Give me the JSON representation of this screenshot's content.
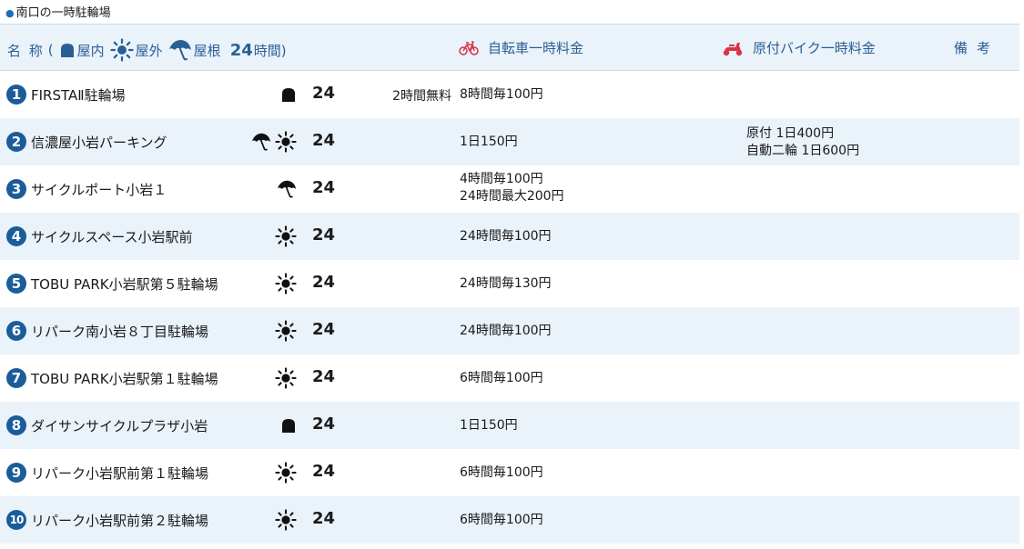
{
  "section": {
    "title": "南口の一時駐輪場"
  },
  "header": {
    "name_label": "名 称",
    "legend_open_paren": "(",
    "legend_indoor": "屋内",
    "legend_outdoor": "屋外",
    "legend_roof": "屋根",
    "legend_24": "24",
    "legend_hours": "時間)",
    "bike_fee": "自転車一時料金",
    "moto_fee": "原付バイク一時料金",
    "remarks": "備考"
  },
  "colors": {
    "header_bg": "#eaf2fa",
    "accent": "#2a5f95",
    "badge": "#1a5d99",
    "moto_icon": "#d9334b",
    "bike_icon": "#d9334b"
  },
  "rows": [
    {
      "num": "1",
      "name": "FIRSTAⅡ駐輪場",
      "icons": [
        "indoor-icon"
      ],
      "hours": "24",
      "note": "2時間無料",
      "bike": [
        "8時間毎100円"
      ],
      "moto": []
    },
    {
      "num": "2",
      "name": "信濃屋小岩パーキング",
      "icons": [
        "umbrella-icon",
        "sun-icon"
      ],
      "hours": "24",
      "note": "",
      "bike": [
        "1日150円"
      ],
      "moto": [
        "原付 1日400円",
        "自動二輪 1日600円"
      ]
    },
    {
      "num": "3",
      "name": "サイクルポート小岩１",
      "icons": [
        "umbrella-icon"
      ],
      "hours": "24",
      "note": "",
      "bike": [
        "4時間毎100円",
        "24時間最大200円"
      ],
      "moto": []
    },
    {
      "num": "4",
      "name": "サイクルスペース小岩駅前",
      "icons": [
        "sun-icon"
      ],
      "hours": "24",
      "note": "",
      "bike": [
        "24時間毎100円"
      ],
      "moto": []
    },
    {
      "num": "5",
      "name": "TOBU PARK小岩駅第５駐輪場",
      "icons": [
        "sun-icon"
      ],
      "hours": "24",
      "note": "",
      "bike": [
        "24時間毎130円"
      ],
      "moto": []
    },
    {
      "num": "6",
      "name": "リパーク南小岩８丁目駐輪場",
      "icons": [
        "sun-icon"
      ],
      "hours": "24",
      "note": "",
      "bike": [
        "24時間毎100円"
      ],
      "moto": []
    },
    {
      "num": "7",
      "name": "TOBU PARK小岩駅第１駐輪場",
      "icons": [
        "sun-icon"
      ],
      "hours": "24",
      "note": "",
      "bike": [
        "6時間毎100円"
      ],
      "moto": []
    },
    {
      "num": "8",
      "name": "ダイサンサイクルプラザ小岩",
      "icons": [
        "indoor-icon"
      ],
      "hours": "24",
      "note": "",
      "bike": [
        "1日150円"
      ],
      "moto": []
    },
    {
      "num": "9",
      "name": "リパーク小岩駅前第１駐輪場",
      "icons": [
        "sun-icon"
      ],
      "hours": "24",
      "note": "",
      "bike": [
        "6時間毎100円"
      ],
      "moto": []
    },
    {
      "num": "10",
      "name": "リパーク小岩駅前第２駐輪場",
      "icons": [
        "sun-icon"
      ],
      "hours": "24",
      "note": "",
      "bike": [
        "6時間毎100円"
      ],
      "moto": []
    }
  ]
}
